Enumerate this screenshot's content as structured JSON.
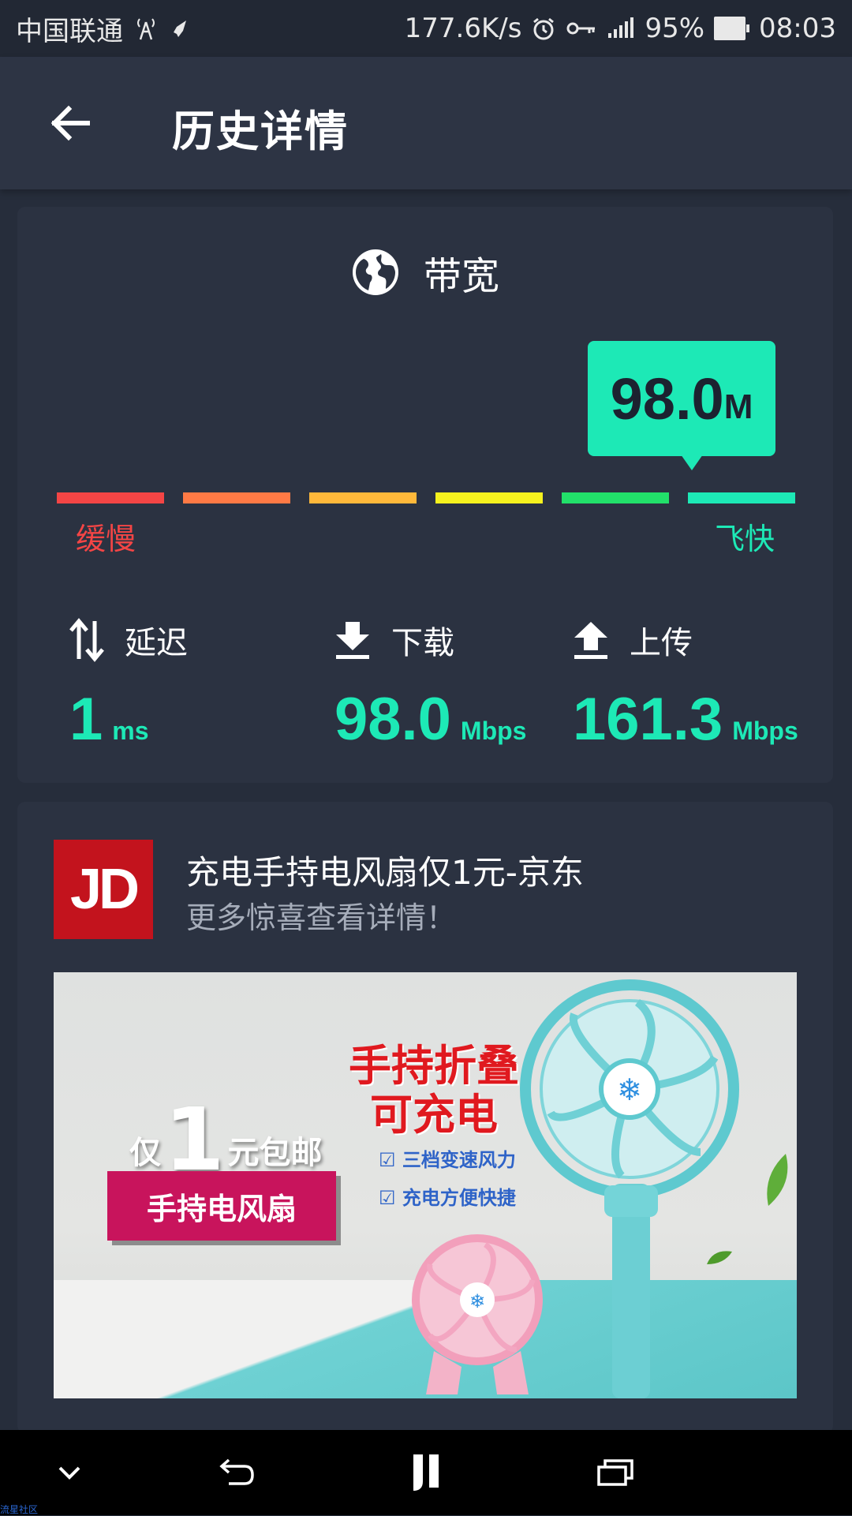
{
  "status_bar": {
    "carrier": "中国联通",
    "speed": "177.6K/s",
    "battery": "95%",
    "time": "08:03"
  },
  "app_bar": {
    "title": "历史详情"
  },
  "bandwidth_card": {
    "title": "带宽",
    "speed_value": "98.0",
    "speed_unit": "M",
    "scale_low_label": "缓慢",
    "scale_high_label": "飞快",
    "scale_colors": [
      "#f44545",
      "#ff7a45",
      "#ffb83a",
      "#f6f21e",
      "#22e06a",
      "#1de9b6"
    ],
    "metrics": {
      "latency": {
        "label": "延迟",
        "value": "1",
        "unit": "ms"
      },
      "download": {
        "label": "下载",
        "value": "98.0",
        "unit": "Mbps"
      },
      "upload": {
        "label": "上传",
        "value": "161.3",
        "unit": "Mbps"
      }
    }
  },
  "ad_card": {
    "logo_text": "JD",
    "title": "充电手持电风扇仅1元-京东",
    "subtitle": "更多惊喜查看详情！",
    "banner": {
      "only_prefix": "仅",
      "only_number": "1",
      "only_suffix": "元包邮",
      "product_pill": "手持电风扇",
      "headline_line1": "手持折叠",
      "headline_line2": "可充电",
      "bullet1": "三档变速风力",
      "bullet2": "充电方便快捷"
    }
  },
  "watermark": "流星社区",
  "colors": {
    "accent": "#1de9b6",
    "background": "#262d3b",
    "card": "#2b3241",
    "slow_red": "#f44545"
  }
}
